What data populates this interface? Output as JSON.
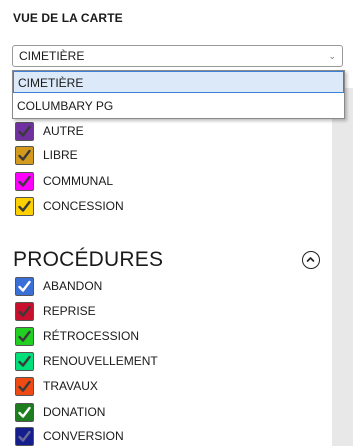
{
  "map_view": {
    "heading": "VUE DE LA CARTE",
    "selected": "CIMETIÈRE",
    "options": [
      "CIMETIÈRE",
      "COLUMBARY PG"
    ]
  },
  "status_items": [
    {
      "label": "AUTRE",
      "color": "#7030a0"
    },
    {
      "label": "LIBRE",
      "color": "#d49a1e"
    },
    {
      "label": "COMMUNAL",
      "color": "#ff00ff"
    },
    {
      "label": "CONCESSION",
      "color": "#ffd000"
    }
  ],
  "procedures": {
    "title": "PROCÉDURES",
    "items": [
      {
        "label": "ABANDON",
        "color": "#3a6fd8"
      },
      {
        "label": "REPRISE",
        "color": "#c8102e"
      },
      {
        "label": "RÉTROCESSION",
        "color": "#22d022"
      },
      {
        "label": "RENOUVELLEMENT",
        "color": "#00e07a"
      },
      {
        "label": "TRAVAUX",
        "color": "#f04a14"
      },
      {
        "label": "DONATION",
        "color": "#1e7d1e"
      },
      {
        "label": "CONVERSION",
        "color": "#141e8c"
      }
    ]
  },
  "icons": {
    "select_chevron": "chevron-down-icon",
    "collapse": "chevron-up-circle-icon"
  }
}
